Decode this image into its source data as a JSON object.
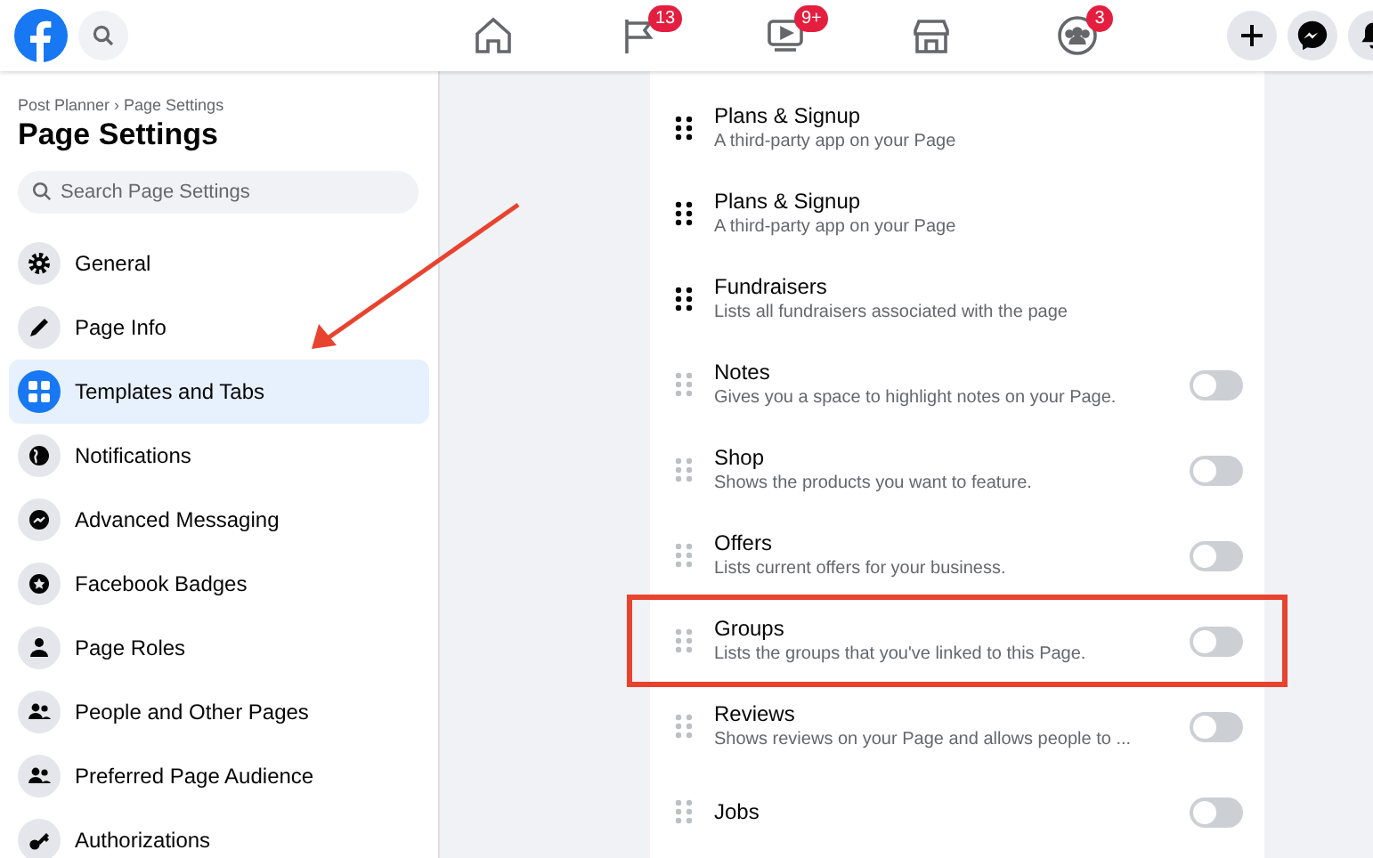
{
  "top_bar": {
    "nav": [
      {
        "kind": "home"
      },
      {
        "kind": "flag",
        "badge": "13"
      },
      {
        "kind": "video",
        "badge": "9+"
      },
      {
        "kind": "store"
      },
      {
        "kind": "groups",
        "badge": "3"
      }
    ],
    "actions": [
      {
        "kind": "plus"
      },
      {
        "kind": "messenger"
      },
      {
        "kind": "bell"
      }
    ]
  },
  "sidebar": {
    "breadcrumb": "Post Planner › Page Settings",
    "title": "Page Settings",
    "search": {
      "placeholder": "Search Page Settings"
    },
    "items": [
      {
        "label": "General",
        "kind": "gear",
        "selected": false
      },
      {
        "label": "Page Info",
        "kind": "pencil",
        "selected": false
      },
      {
        "label": "Templates and Tabs",
        "kind": "grid",
        "selected": true
      },
      {
        "label": "Notifications",
        "kind": "globe",
        "selected": false
      },
      {
        "label": "Advanced Messaging",
        "kind": "messenger",
        "selected": false
      },
      {
        "label": "Facebook Badges",
        "kind": "star",
        "selected": false
      },
      {
        "label": "Page Roles",
        "kind": "person",
        "selected": false
      },
      {
        "label": "People and Other Pages",
        "kind": "people",
        "selected": false
      },
      {
        "label": "Preferred Page Audience",
        "kind": "people",
        "selected": false
      },
      {
        "label": "Authorizations",
        "kind": "key",
        "selected": false
      }
    ]
  },
  "tabs_list": {
    "rows": [
      {
        "kind": "fixed",
        "title": "Plans & Signup",
        "description": "A third-party app on your Page"
      },
      {
        "kind": "fixed",
        "title": "Plans & Signup",
        "description": "A third-party app on your Page"
      },
      {
        "kind": "fixed",
        "title": "Fundraisers",
        "description": "Lists all fundraisers associated with the page"
      },
      {
        "kind": "toggle",
        "title": "Notes",
        "description": "Gives you a space to highlight notes on your Page.",
        "on": false
      },
      {
        "kind": "toggle",
        "title": "Shop",
        "description": "Shows the products you want to feature.",
        "on": false
      },
      {
        "kind": "toggle",
        "title": "Offers",
        "description": "Lists current offers for your business.",
        "on": false
      },
      {
        "kind": "toggle",
        "title": "Groups",
        "description": "Lists the groups that you've linked to this Page.",
        "on": false,
        "highlighted": true
      },
      {
        "kind": "toggle",
        "title": "Reviews",
        "description": "Shows reviews on your Page and allows people to ...",
        "on": false
      },
      {
        "kind": "toggle",
        "title": "Jobs",
        "on": false
      }
    ]
  }
}
